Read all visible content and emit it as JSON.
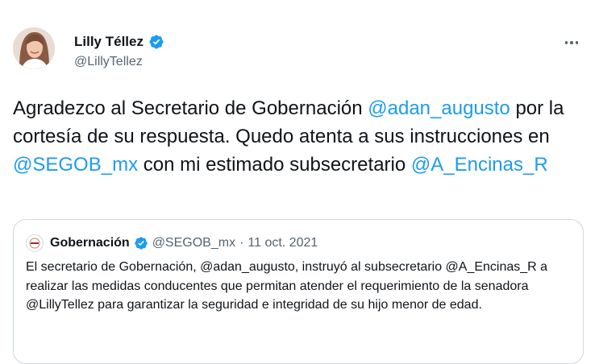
{
  "author": {
    "name": "Lilly Téllez",
    "handle": "@LillyTellez"
  },
  "tweet": {
    "text_1": "Agradezco al Secretario de Gobernación ",
    "mention_1": "@adan_augusto",
    "text_2": " por la cortesía de su respuesta. Quedo atenta a sus instrucciones en ",
    "mention_2": "@SEGOB_mx",
    "text_3": " con mi estimado subsecretario ",
    "mention_3": "@A_Encinas_R"
  },
  "quoted": {
    "name": "Gobernación",
    "handle": "@SEGOB_mx",
    "separator": "·",
    "date": "11 oct. 2021",
    "text": "El secretario de Gobernación, @adan_augusto, instruyó al subsecretario @A_Encinas_R a realizar las medidas conducentes que permitan atender el requerimiento de la senadora @LillyTellez para garantizar la seguridad e integridad de su hijo menor de edad."
  },
  "colors": {
    "link": "#1d9bf0",
    "text": "#0f1419",
    "secondary": "#536471",
    "border": "#cfd9de"
  },
  "icons": {
    "verified": "verified-badge-icon",
    "more": "more-options-icon"
  }
}
